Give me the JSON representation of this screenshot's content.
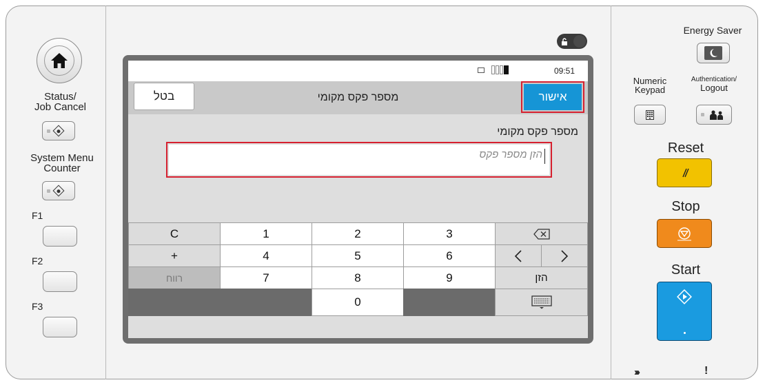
{
  "left_panel": {
    "status_label": "Status/\nJob Cancel",
    "system_menu_label": "System Menu\nCounter",
    "f1_label": "F1",
    "f2_label": "F2",
    "f3_label": "F3"
  },
  "screen": {
    "status_bar": {
      "time": "09:51"
    },
    "title_bar": {
      "cancel_label": "בטל",
      "title": "מספר פקס מקומי",
      "ok_label": "אישור"
    },
    "field": {
      "label": "מספר פקס מקומי",
      "placeholder": "הזן מספר פקס",
      "value": ""
    },
    "keypad": {
      "row1": [
        "C",
        "1",
        "2",
        "3"
      ],
      "row2": [
        "+",
        "4",
        "5",
        "6"
      ],
      "row3": [
        "רווח",
        "7",
        "8",
        "9",
        "הזן"
      ],
      "row4": [
        "0"
      ]
    }
  },
  "right_panel": {
    "energy_saver_label": "Energy Saver",
    "numeric_keypad_label": "Numeric\nKeypad",
    "auth_logout_label_top": "Authentication/",
    "auth_logout_label_bottom": "Logout",
    "reset_label": "Reset",
    "stop_label": "Stop",
    "start_label": "Start",
    "indicator_attention": "!"
  },
  "colors": {
    "accent_blue": "#1695d6",
    "highlight_red": "#d6202f",
    "reset_yellow": "#f2c200",
    "stop_orange": "#f08a1c",
    "start_blue": "#1a9be0"
  }
}
